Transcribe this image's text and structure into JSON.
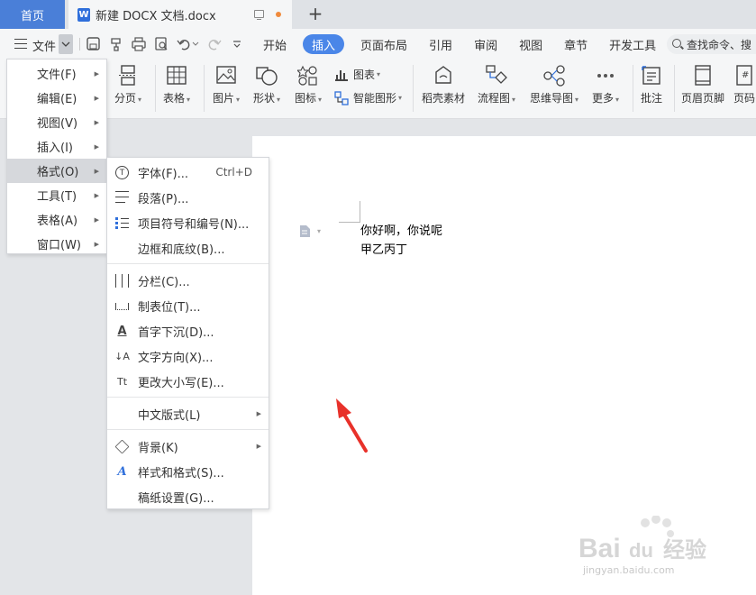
{
  "titlebar": {
    "home_tab": "首页",
    "doc_tab": "新建 DOCX 文档.docx",
    "new_tab_symbol": "+"
  },
  "menubar": {
    "file_label": "文件",
    "tabs": [
      "开始",
      "插入",
      "页面布局",
      "引用",
      "审阅",
      "视图",
      "章节",
      "开发工具"
    ],
    "active_tab": "插入",
    "search_placeholder": "查找命令、搜"
  },
  "ribbon": {
    "page_break": "分页",
    "table": "表格",
    "picture": "图片",
    "shape": "形状",
    "icon": "图标",
    "chart": "图表",
    "smart_art": "智能图形",
    "docer_material": "稻壳素材",
    "flowchart": "流程图",
    "mindmap": "思维导图",
    "more": "更多",
    "comment": "批注",
    "header_footer": "页眉页脚",
    "page_number": "页码"
  },
  "file_menu": {
    "items": [
      "文件(F)",
      "编辑(E)",
      "视图(V)",
      "插入(I)",
      "格式(O)",
      "工具(T)",
      "表格(A)",
      "窗口(W)"
    ],
    "highlighted": "格式(O)"
  },
  "format_menu": {
    "font": "字体(F)...",
    "font_shortcut": "Ctrl+D",
    "paragraph": "段落(P)...",
    "bullets": "项目符号和编号(N)...",
    "borders": "边框和底纹(B)...",
    "columns": "分栏(C)...",
    "tabs": "制表位(T)...",
    "drop_cap": "首字下沉(D)...",
    "text_direction": "文字方向(X)...",
    "change_case": "更改大小写(E)...",
    "chinese_layout": "中文版式(L)",
    "background": "背景(K)",
    "styles": "样式和格式(S)...",
    "manuscript": "稿纸设置(G)..."
  },
  "document": {
    "line1": "你好啊，你说呢",
    "line2": "甲乙丙丁"
  },
  "watermark": {
    "logo": "Bai du 经验",
    "url": "jingyan.baidu.com"
  },
  "colors": {
    "accent": "#4a86e8",
    "home_tab": "#4a7fd8",
    "arrow": "#e8312a"
  }
}
